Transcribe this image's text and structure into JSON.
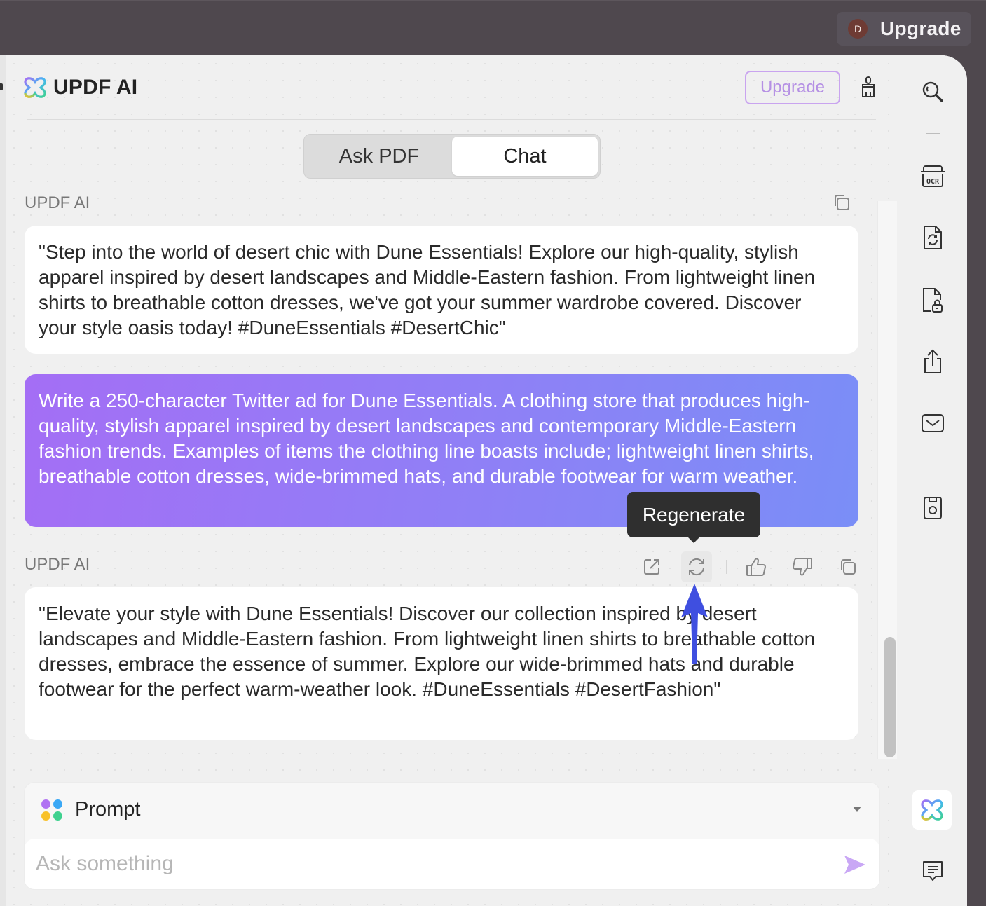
{
  "topbar": {
    "avatar_initial": "D",
    "upgrade_label": "Upgrade"
  },
  "header": {
    "brand_name": "UPDF AI",
    "upgrade_label": "Upgrade"
  },
  "tabs": [
    {
      "label": "Ask PDF",
      "active": false
    },
    {
      "label": "Chat",
      "active": true
    }
  ],
  "messages": [
    {
      "sender": "UPDF AI",
      "role": "ai",
      "text": "\"Step into the world of desert chic with Dune Essentials! Explore our high-quality, stylish apparel inspired by desert landscapes and Middle-Eastern fashion. From lightweight linen shirts to breathable cotton dresses, we've got your summer wardrobe covered. Discover your style oasis today! #DuneEssentials #DesertChic\""
    },
    {
      "role": "user",
      "text": "Write a 250-character Twitter ad for Dune Essentials. A clothing store that produces high-quality, stylish apparel inspired by desert landscapes and contemporary Middle-Eastern fashion trends. Examples of items the clothing line boasts include; lightweight linen shirts, breathable cotton dresses, wide-brimmed hats, and durable footwear for warm weather."
    },
    {
      "sender": "UPDF AI",
      "role": "ai",
      "text": "\"Elevate your style with Dune Essentials! Discover our collection inspired by desert landscapes and Middle-Eastern fashion. From lightweight linen shirts to breathable cotton dresses, embrace the essence of summer. Explore our wide-brimmed hats and durable footwear for the perfect warm-weather look. #DuneEssentials #DesertFashion\""
    }
  ],
  "actions": [
    {
      "icon": "external-link-icon"
    },
    {
      "icon": "regenerate-icon",
      "hovered": true
    },
    {
      "icon": "thumbs-up-icon"
    },
    {
      "icon": "thumbs-down-icon"
    },
    {
      "icon": "copy-icon"
    }
  ],
  "tooltip": {
    "text": "Regenerate"
  },
  "prompt": {
    "label": "Prompt",
    "dot_colors": [
      "#b072f2",
      "#3aa8f5",
      "#f8c12a",
      "#3fd18f"
    ]
  },
  "input": {
    "placeholder": "Ask something",
    "value": ""
  },
  "colors": {
    "accent": "#b590e4",
    "send": "#c9a7f5",
    "user_bubble_start": "#a46ef5",
    "user_bubble_end": "#7a8ef7",
    "annotation_arrow": "#3f4fe0"
  },
  "right_toolbar": [
    {
      "icon": "search-icon"
    },
    {
      "icon": "ocr-icon"
    },
    {
      "icon": "convert-file-icon"
    },
    {
      "icon": "protect-file-icon"
    },
    {
      "icon": "share-icon"
    },
    {
      "icon": "email-icon"
    },
    {
      "icon": "save-icon"
    },
    {
      "icon": "updf-ai-icon",
      "active": true
    },
    {
      "icon": "comment-icon"
    }
  ]
}
